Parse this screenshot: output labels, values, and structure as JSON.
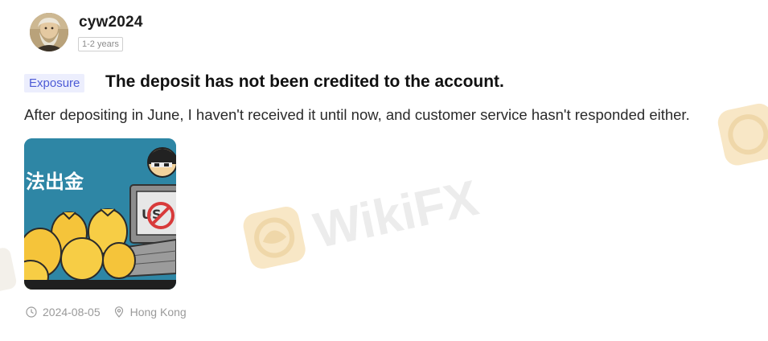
{
  "user": {
    "username": "cyw2024",
    "tenure": "1-2 years",
    "avatar_icon": "user-avatar"
  },
  "post": {
    "category": "Exposure",
    "title": "The deposit has not been credited to the account.",
    "body": "After depositing in June, I haven't received it until now, and customer service hasn't responded either.",
    "image_caption": "法出金",
    "date": "2024-08-05",
    "location": "Hong Kong",
    "date_icon": "clock-icon",
    "location_icon": "location-pin-icon"
  },
  "watermark": {
    "text": "WikiFX"
  },
  "colors": {
    "tag_bg": "#eceefd",
    "tag_text": "#4d5bd6",
    "meta_text": "#9a9a9a",
    "watermark_gold": "#f5dfb8",
    "watermark_gray": "#e4e4e4"
  }
}
